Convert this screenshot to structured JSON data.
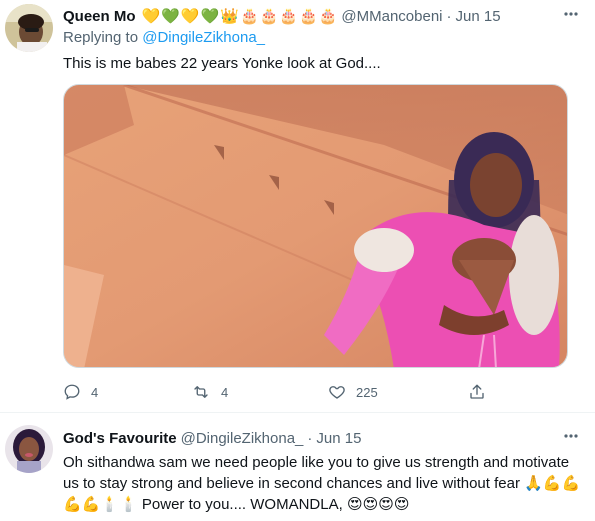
{
  "tweet1": {
    "name": "Queen Mo",
    "name_emojis": [
      "💛",
      "💚",
      "💛",
      "💚",
      "👑",
      "🎂",
      "🎂",
      "🎂",
      "🎂",
      "🎂"
    ],
    "handle": "@MMancobeni",
    "dot": "·",
    "date": "Jun 15",
    "replying_prefix": "Replying to ",
    "replying_to": "@DingileZikhona_",
    "text": "This is me babes 22 years Yonke look at God....",
    "replies": "4",
    "retweets": "4",
    "likes": "225",
    "more_icon": "more-icon"
  },
  "tweet2": {
    "name": "God's Favourite",
    "handle": "@DingileZikhona_",
    "dot": "·",
    "date": "Jun 15",
    "text_main": "Oh sithandwa sam we need people like you to give us strength and motivate us to stay strong and believe in second chances and live without fear ",
    "emojis_1": "🙏💪💪💪💪🕯️🕯️",
    "text_mid": " Power to you.... WOMANDLA, ",
    "emojis_2": "😍😍😍😍"
  },
  "colors": {
    "link": "#1d9bf0",
    "secondary": "#536471",
    "border": "#cfd9de"
  }
}
